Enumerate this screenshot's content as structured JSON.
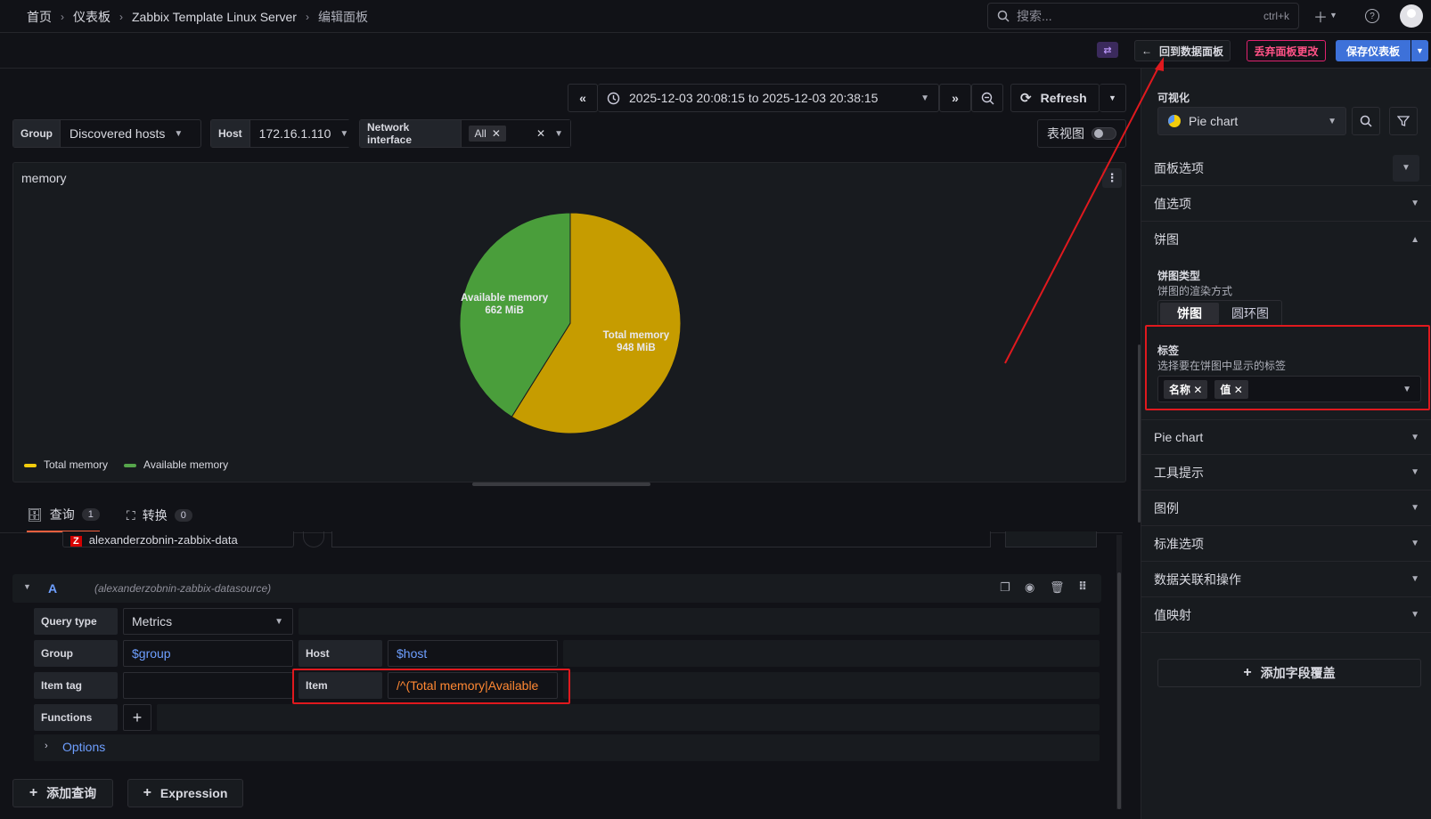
{
  "breadcrumb": [
    "首页",
    "仪表板",
    "Zabbix Template Linux Server",
    "编辑面板"
  ],
  "search": {
    "placeholder": "搜索...",
    "shortcut": "ctrl+k"
  },
  "toolbar": {
    "back": "回到数据面板",
    "discard": "丢弃面板更改",
    "save": "保存仪表板"
  },
  "time": {
    "range": "2025-12-03 20:08:15 to 2025-12-03 20:38:15",
    "refresh": "Refresh"
  },
  "variables": [
    {
      "label": "Group",
      "value": "Discovered hosts"
    },
    {
      "label": "Host",
      "value": "172.16.1.110"
    },
    {
      "label": "Network interface",
      "value": "All"
    }
  ],
  "table_view": "表视图",
  "panel": {
    "title": "memory"
  },
  "chart_data": {
    "type": "pie",
    "series": [
      {
        "name": "Total memory",
        "value": 948,
        "unit": "MiB",
        "color": "#c69c00"
      },
      {
        "name": "Available memory",
        "value": 662,
        "unit": "MiB",
        "color": "#4a9e3b"
      }
    ],
    "slice_labels": [
      {
        "name": "Available memory",
        "value": "662 MiB"
      },
      {
        "name": "Total memory",
        "value": "948 MiB"
      }
    ],
    "legend": [
      "Total memory",
      "Available memory"
    ],
    "legend_position": "bottom-left"
  },
  "tabs": [
    {
      "label": "查询",
      "count": "1"
    },
    {
      "label": "转换",
      "count": "0"
    }
  ],
  "query": {
    "ref": "A",
    "datasource": "(alexanderzobnin-zabbix-datasource)",
    "datasource_short": "alexanderzobnin-zabbix-data",
    "query_type_label": "Query type",
    "query_type": "Metrics",
    "group_label": "Group",
    "group": "$group",
    "host_label": "Host",
    "host": "$host",
    "item_tag_label": "Item tag",
    "item_label": "Item",
    "item": "/^(Total memory|Available",
    "functions_label": "Functions",
    "options_label": "Options",
    "add_query": "添加查询",
    "expression": "Expression"
  },
  "sidebar": {
    "visualization_label": "可视化",
    "visualization": "Pie chart",
    "sections": [
      "面板选项",
      "值选项"
    ],
    "pie_section": "饼图",
    "pie_type_label": "饼图类型",
    "pie_type_desc": "饼图的渲染方式",
    "pie_type_options": [
      "饼图",
      "圆环图"
    ],
    "labels_label": "标签",
    "labels_desc": "选择要在饼图中显示的标签",
    "labels_values": [
      "名称",
      "值"
    ],
    "more_sections": [
      "Pie chart",
      "工具提示",
      "图例",
      "标准选项",
      "数据关联和操作",
      "值映射"
    ],
    "add_override": "添加字段覆盖"
  },
  "colors": {
    "accent": "#3d71d9",
    "danger": "#ff5286",
    "highlight": "#e0191e",
    "link": "#6e9fff",
    "orange": "#ff8833"
  }
}
